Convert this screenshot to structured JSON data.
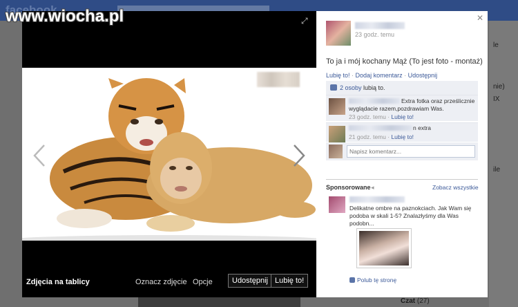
{
  "watermark": "www.wiocha.pl",
  "background": {
    "logo": "facebook",
    "right_labels": [
      "le",
      "nie)",
      "IX",
      "ile"
    ],
    "chat_label": "Czat",
    "chat_count": "(27)"
  },
  "viewer": {
    "album_title": "Zdjęcia na tablicy",
    "tag_photo": "Oznacz zdjęcie",
    "options": "Opcje",
    "share_button": "Udostępnij",
    "like_button": "Lubię to!"
  },
  "post": {
    "time": "23 godz. temu",
    "text": "To ja i mój kochany Mąż (To jest foto - montaż)",
    "actions": [
      "Lubię to!",
      "Dodaj komentarz",
      "Udostępnij"
    ],
    "likes_link": "2 osoby",
    "likes_suffix": " lubią to.",
    "comments": [
      {
        "text": "Extra fotka oraz prześlicznie wyglądacie razem,pozdrawiam Was.",
        "time": "23 godz. temu",
        "like": "Lubię to!"
      },
      {
        "text": "n extra",
        "time": "21 godz. temu",
        "like": "Lubię to!"
      }
    ],
    "comment_placeholder": "Napisz komentarz..."
  },
  "sponsored": {
    "title": "Sponsorowane",
    "icon": "megaphone-icon",
    "see_all": "Zobacz wszystkie",
    "ad_text": "Delikatne ombre na paznokciach. Jak Wam się podoba w skali 1-5? Znalazłyśmy dla Was podobn...",
    "like_page": "Polub tę stronę"
  },
  "colors": {
    "link": "#3b5998",
    "panel_bg": "#ffffff",
    "comment_bg": "#edeff4",
    "viewer_bg": "#000000"
  }
}
